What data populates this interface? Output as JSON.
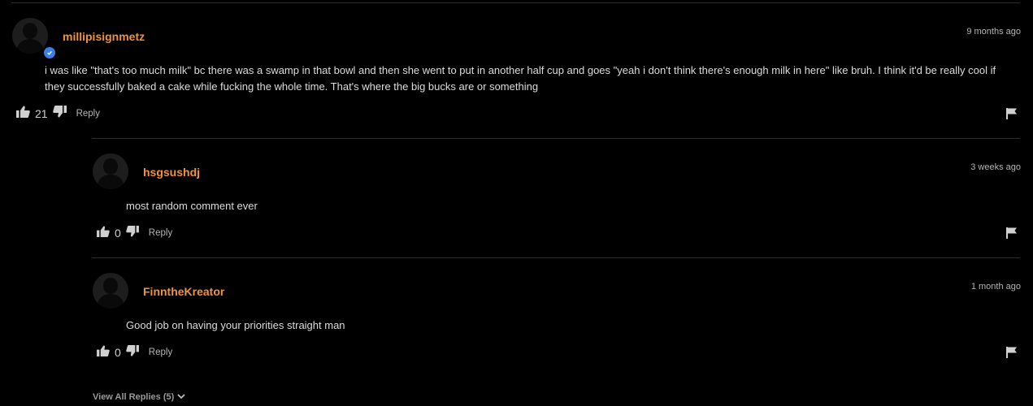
{
  "comments": [
    {
      "username": "millipisignmetz",
      "time": "9 months ago",
      "text": "i was like \"that's too much milk\" bc there was a swamp in that bowl and then she went to put in another half cup and goes \"yeah i don't think there's enough milk in here\" like bruh. I think it'd be really cool if they successfully baked a cake while fucking the whole time. That's where the big bucks are or something",
      "likes": "21",
      "reply_label": "Reply",
      "verified": true
    }
  ],
  "replies": [
    {
      "username": "hsgsushdj",
      "time": "3 weeks ago",
      "text": "most random comment ever",
      "likes": "0",
      "reply_label": "Reply"
    },
    {
      "username": "FinntheKreator",
      "time": "1 month ago",
      "text": "Good job on having your priorities straight man",
      "likes": "0",
      "reply_label": "Reply"
    }
  ],
  "view_all_replies": "View All Replies (5)",
  "colors": {
    "username": "#f0923e",
    "verified": "#3d7ee6",
    "background": "#000000"
  },
  "icons": [
    "verified-check-icon",
    "thumbs-up-icon",
    "thumbs-down-icon",
    "flag-icon",
    "chevron-down-icon"
  ]
}
